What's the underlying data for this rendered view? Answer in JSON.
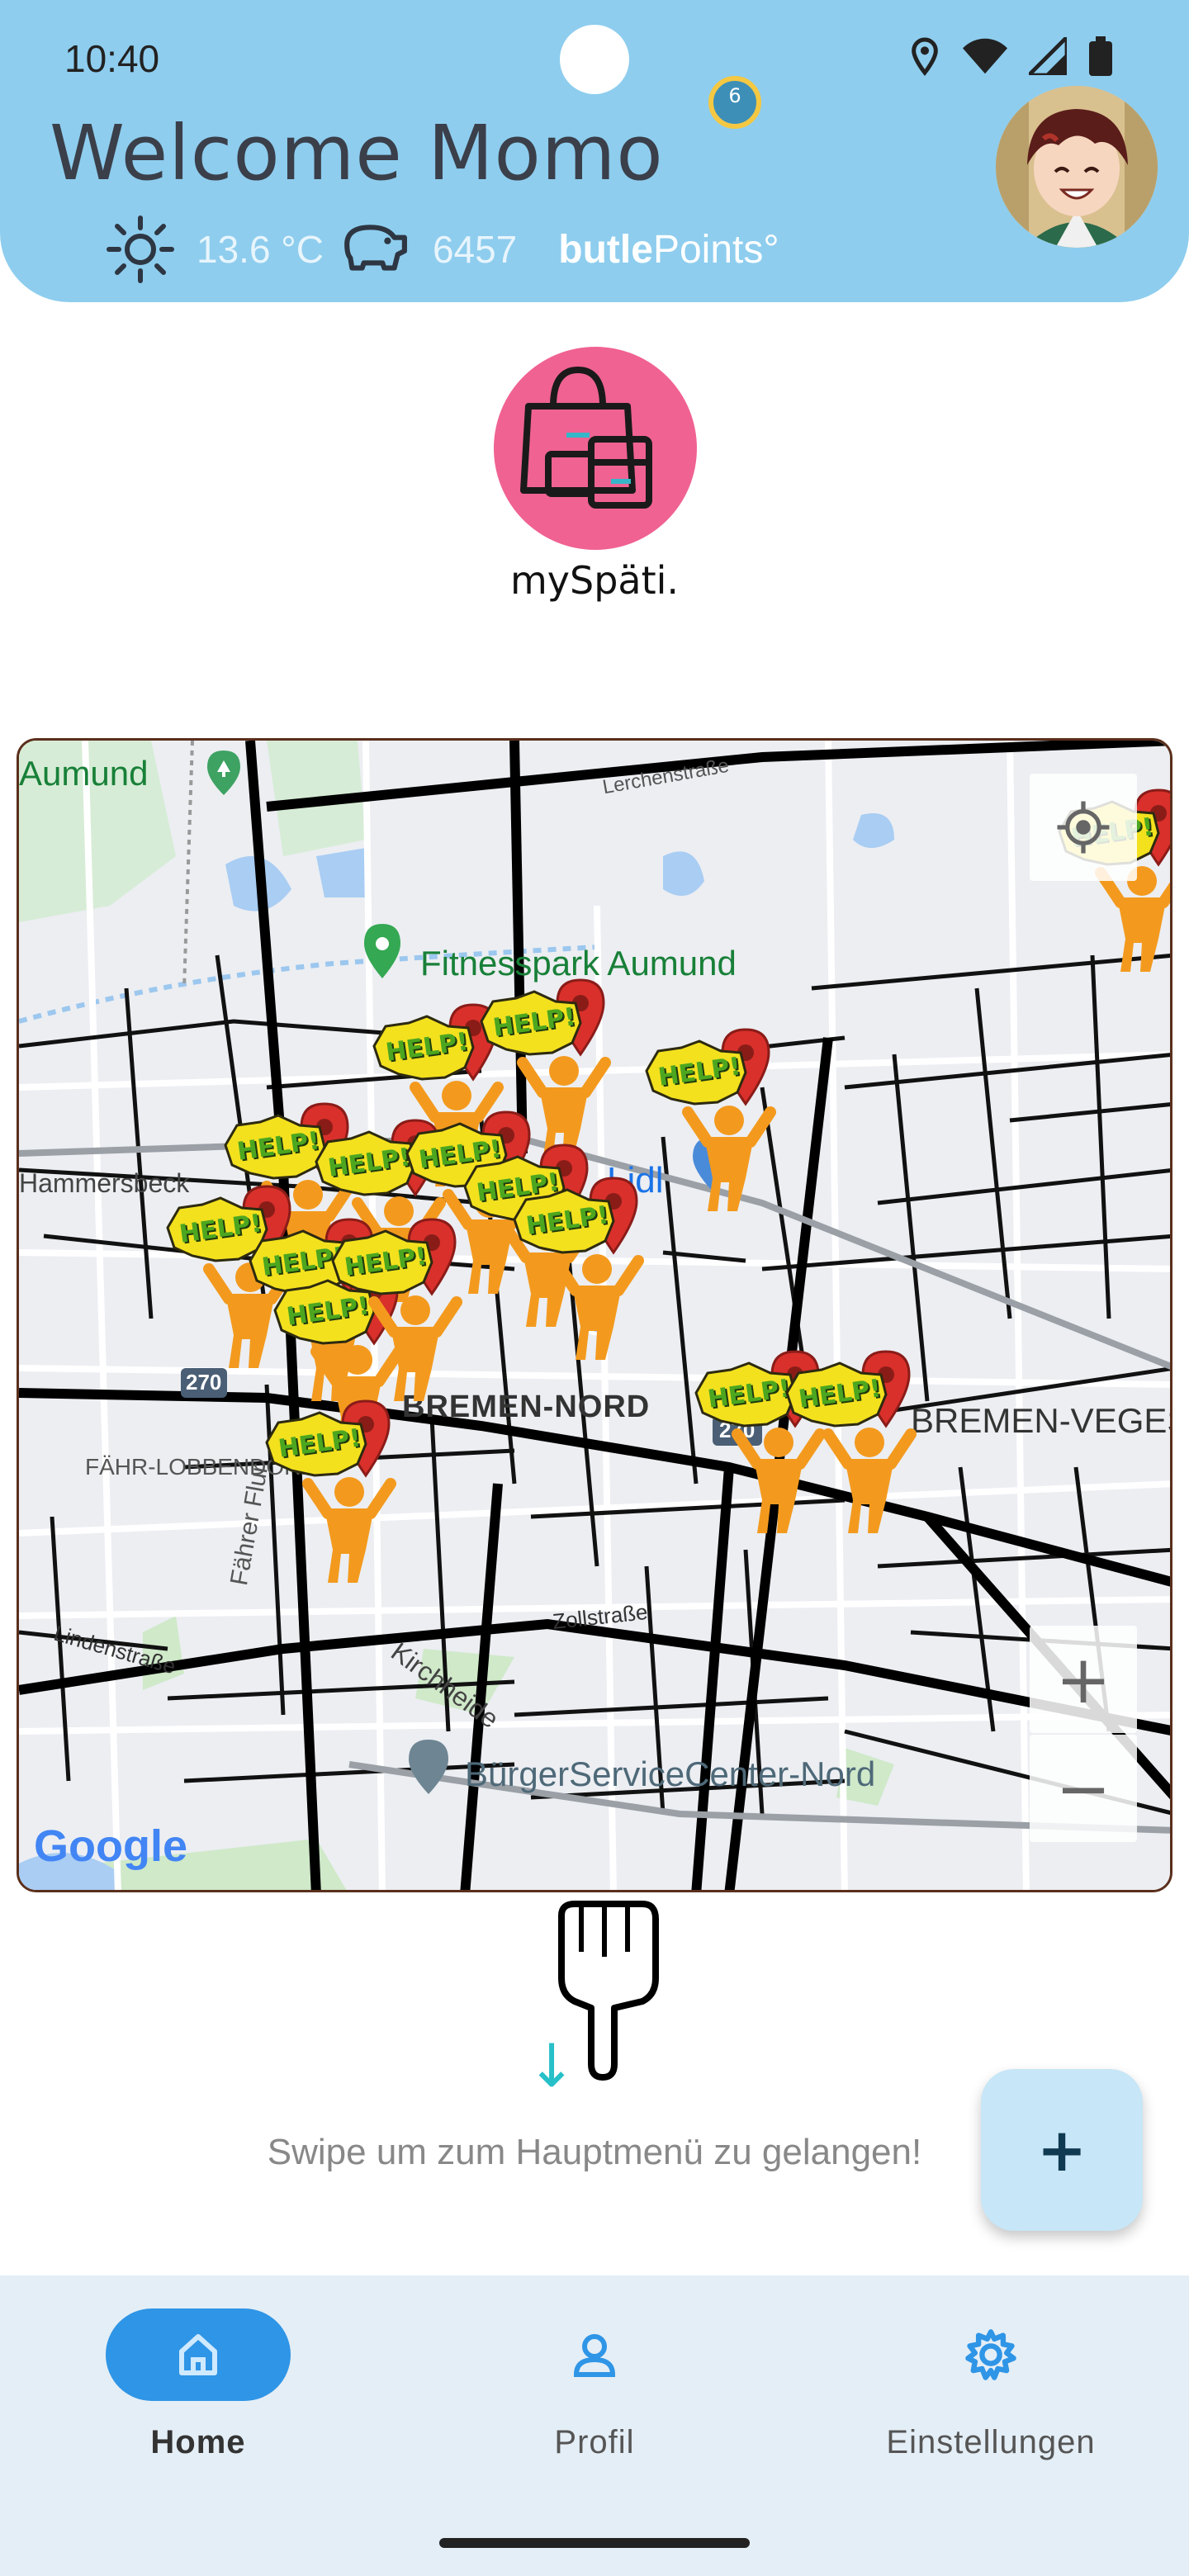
{
  "status_bar": {
    "time": "10:40",
    "icons": [
      "location-icon",
      "wifi-icon",
      "signal-icon",
      "battery-icon"
    ]
  },
  "header": {
    "welcome": "Welcome Momo",
    "level": "6",
    "temperature": "13.6 °C",
    "points_value": "6457",
    "brand_bold": "butle",
    "brand_light": "Points°",
    "background_color": "#8ecdee"
  },
  "app": {
    "name": "mySpäti.",
    "icon_color": "#f06292"
  },
  "map": {
    "labels": {
      "aumund": "Aumund",
      "fitness": "Fitnesspark Aumund",
      "lerchen": "Lerchenstraße",
      "hammersbeck": "Hammersbeck",
      "lidl": "Lidl",
      "bremen_nord": "BREMEN-NORD",
      "vegesack": "BREMEN-VEGESACK",
      "faehr": "FÄHR-LOBBENDORF",
      "zoll": "Zollstraße",
      "linden": "Lindenstraße",
      "kirchheide": "Kirchheide",
      "buerger": "BürgerServiceCenter-Nord",
      "faehrer": "Fährer Flur",
      "road_270_a": "270",
      "road_270_b": "270",
      "google": "Google"
    },
    "help_text": "HELP!",
    "zoom_in": "+",
    "zoom_out": "−"
  },
  "swipe_hint": "Swipe um zum Hauptmenü zu gelangen!",
  "fab_label": "+",
  "nav": {
    "items": [
      {
        "label": "Home",
        "icon": "home-icon",
        "active": true
      },
      {
        "label": "Profil",
        "icon": "profile-icon",
        "active": false
      },
      {
        "label": "Einstellungen",
        "icon": "settings-icon",
        "active": false
      }
    ]
  }
}
